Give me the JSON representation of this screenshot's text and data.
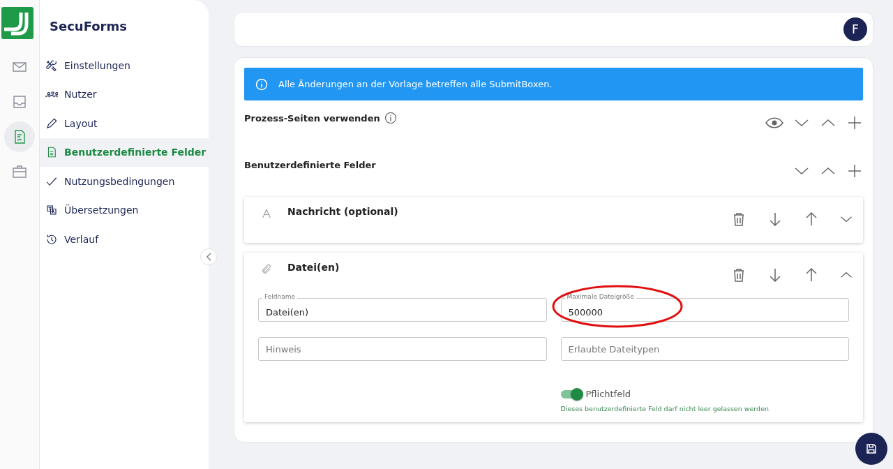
{
  "rail": {
    "items": [
      {
        "selected": false
      },
      {
        "selected": false
      },
      {
        "selected": true
      },
      {
        "selected": false
      }
    ]
  },
  "sidebar": {
    "title": "SecuForms",
    "items": [
      {
        "label": "Einstellungen",
        "selected": false
      },
      {
        "label": "Nutzer",
        "selected": false
      },
      {
        "label": "Layout",
        "selected": false
      },
      {
        "label": "Benutzerdefinierte Felder",
        "selected": true
      },
      {
        "label": "Nutzungsbedingungen",
        "selected": false
      },
      {
        "label": "Übersetzungen",
        "selected": false
      },
      {
        "label": "Verlauf",
        "selected": false
      }
    ]
  },
  "header": {
    "avatar": "F"
  },
  "banner": {
    "text": "Alle Änderungen an der Vorlage betreffen alle SubmitBoxen."
  },
  "sections": [
    {
      "title": "Prozess-Seiten verwenden",
      "info": true
    },
    {
      "title": "Benutzerdefinierte Felder",
      "info": false
    }
  ],
  "fields": [
    {
      "kind": "text",
      "title": "Nachricht (optional)",
      "expanded": false
    },
    {
      "kind": "file",
      "title": "Datei(en)",
      "expanded": true,
      "inputs": [
        {
          "label": "Feldname",
          "value": "Datei(en)",
          "highlighted": false
        },
        {
          "label": "Maximale Dateigröße",
          "value": "500000",
          "highlighted": true
        },
        {
          "placeholder": "Hinweis",
          "highlighted": false
        },
        {
          "placeholder": "Erlaubte Dateitypen",
          "highlighted": false
        }
      ],
      "required": {
        "label": "Pflichtfeld",
        "on": true,
        "hint": "Dieses benutzerdefinierte Feld darf nicht leer gelassen werden"
      }
    }
  ]
}
